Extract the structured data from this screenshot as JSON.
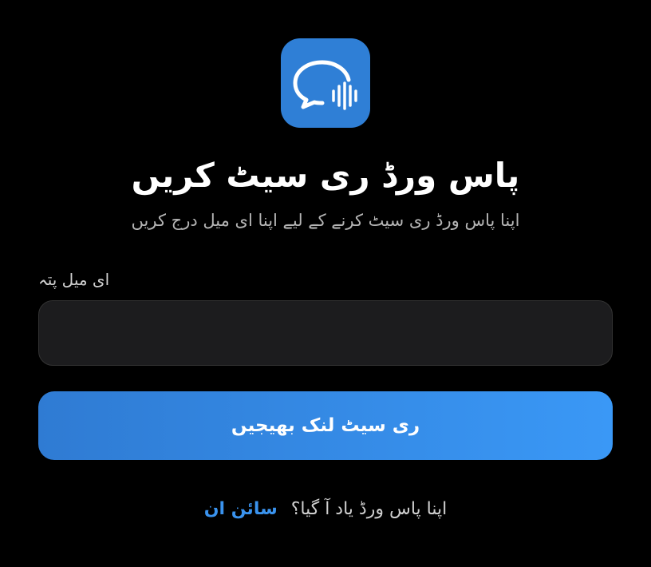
{
  "app": {
    "icon": "chat-bubble-soundwave-icon",
    "icon_color": "#2f7fd6"
  },
  "header": {
    "title": "پاس ورڈ ری سیٹ کریں",
    "subtitle": "اپنا پاس ورڈ ری سیٹ کرنے کے لیے اپنا ای میل درج کریں"
  },
  "form": {
    "email_label": "ای میل پتہ",
    "email_value": "",
    "email_placeholder": "",
    "submit_label": "ری سیٹ لنک بھیجیں"
  },
  "footer": {
    "prompt": "اپنا پاس ورڈ یاد آ گیا؟",
    "signin_label": "سائن ان",
    "link_color": "#3a93ee"
  },
  "colors": {
    "background": "#000000",
    "button_gradient_start": "#2f7bd3",
    "button_gradient_end": "#3a98f6",
    "input_background": "#1c1c1e"
  }
}
